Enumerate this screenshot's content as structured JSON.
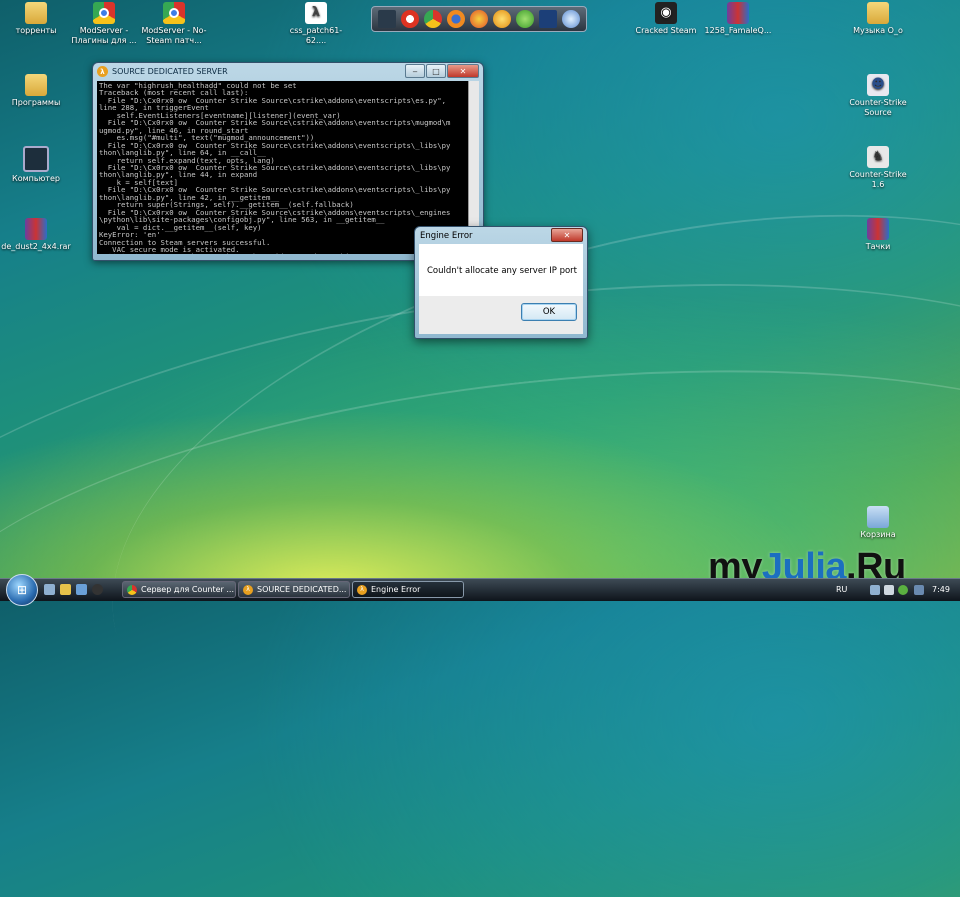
{
  "desktop": {
    "icons": [
      {
        "label": "торренты",
        "icon": "folder-icon"
      },
      {
        "label": "ModServer - Плагины для ...",
        "icon": "chrome-icon"
      },
      {
        "label": "ModServer - No-Steam патч...",
        "icon": "chrome-icon"
      },
      {
        "label": "css_patch61-62....",
        "icon": "half-life-icon"
      },
      {
        "label": "Cracked Steam",
        "icon": "steam-icon"
      },
      {
        "label": "1258_FamaleQ...",
        "icon": "winrar-icon"
      },
      {
        "label": "Музыка О_о",
        "icon": "folder-icon"
      },
      {
        "label": "Программы",
        "icon": "folder-icon"
      },
      {
        "label": "Компьютер",
        "icon": "computer-icon"
      },
      {
        "label": "de_dust2_4x4.rar",
        "icon": "winrar-icon"
      },
      {
        "label": "Counter-Strike Source",
        "icon": "cs-source-icon"
      },
      {
        "label": "Counter-Strike 1.6",
        "icon": "cs16-icon"
      },
      {
        "label": "Тачки",
        "icon": "winrar-icon"
      },
      {
        "label": "Корзина",
        "icon": "recycle-bin-icon"
      }
    ]
  },
  "console": {
    "title": "SOURCE DEDICATED SERVER",
    "lines": "The var \"highrush_healthadd\" could not be set\nTraceback (most recent call last):\n  File \"D:\\Cx0rx0 ow  Counter Strike Source\\cstrike\\addons\\eventscripts\\es.py\",\nline 288, in triggerEvent\n    self.EventListeners[eventname][listener](event_var)\n  File \"D:\\Cx0rx0 ow  Counter Strike Source\\cstrike\\addons\\eventscripts\\mugmod\\m\nugmod.py\", line 46, in round_start\n    es.msg(\"#multi\", text(\"mugmod_announcement\"))\n  File \"D:\\Cx0rx0 ow  Counter Strike Source\\cstrike\\addons\\eventscripts\\_libs\\py\nthon\\langlib.py\", line 64, in __call__\n    return self.expand(text, opts, lang)\n  File \"D:\\Cx0rx0 ow  Counter Strike Source\\cstrike\\addons\\eventscripts\\_libs\\py\nthon\\langlib.py\", line 44, in expand\n    k = self[text]\n  File \"D:\\Cx0rx0 ow  Counter Strike Source\\cstrike\\addons\\eventscripts\\_libs\\py\nthon\\langlib.py\", line 42, in __getitem__\n    return super(Strings, self).__getitem__(self.fallback)\n  File \"D:\\Cx0rx0 ow  Counter Strike Source\\cstrike\\addons\\eventscripts\\_engines\n\\python\\lib\\site-packages\\configobj.py\", line 563, in __getitem__\n    val = dict.__getitem__(self, key)\nKeyError: 'en'\nConnection to Steam servers successful.\n   VAC secure mode is activated.\n¤¤¦¦¤¦ ¤¦ ¦¤¦ FrozDarka: Psycho Quake, Hide'n'Seek, ZombieMOD",
    "controls": {
      "minimize": "‒",
      "maximize": "□",
      "close": "✕"
    }
  },
  "dialog": {
    "title": "Engine Error",
    "message": "Couldn't allocate any server IP port",
    "ok_label": "OK",
    "close_glyph": "✕"
  },
  "watermark": {
    "brand": "myJulia.Ru"
  },
  "taskbar": {
    "tasks": [
      {
        "label": "Сервер для Counter ..."
      },
      {
        "label": "SOURCE DEDICATED..."
      },
      {
        "label": "Engine Error"
      }
    ],
    "language": "RU",
    "clock": "7:49"
  },
  "colors": {
    "accent": "#1b6fc0",
    "close_red": "#c0392b"
  }
}
